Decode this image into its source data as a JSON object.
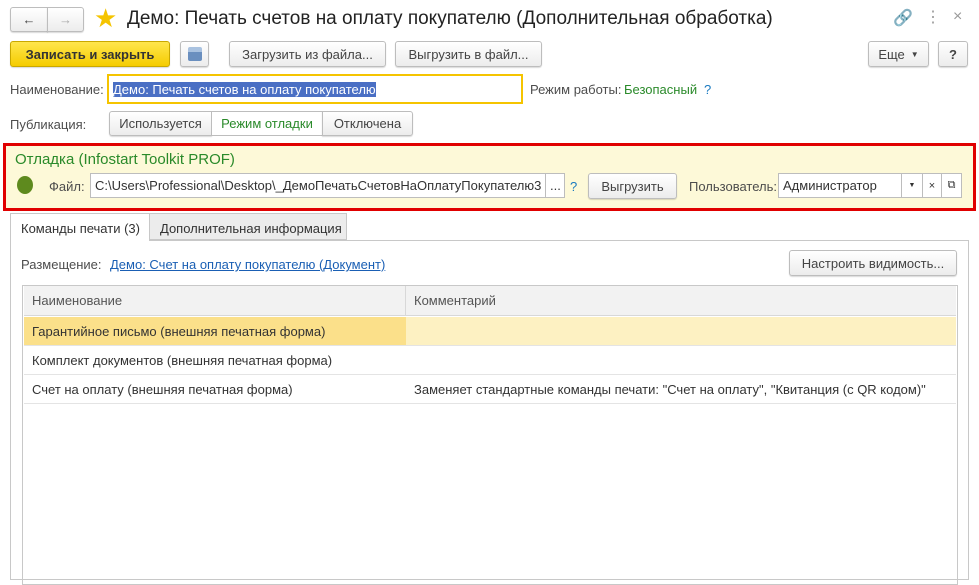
{
  "window": {
    "title": "Демо: Печать счетов на оплату покупателю (Дополнительная обработка)"
  },
  "toolbar": {
    "save_close": "Записать и закрыть",
    "load": "Загрузить из файла...",
    "unload": "Выгрузить в файл...",
    "more": "Еще",
    "help": "?"
  },
  "form": {
    "name_label": "Наименование:",
    "name_value": "Демо: Печать счетов на оплату покупателю",
    "mode_label": "Режим работы:",
    "mode_value": "Безопасный",
    "mode_help": "?",
    "publication_label": "Публикация:",
    "publication_options": [
      "Используется",
      "Режим отладки",
      "Отключена"
    ],
    "publication_selected": "Режим отладки"
  },
  "debug": {
    "title": "Отладка (Infostart Toolkit PROF)",
    "file_label": "Файл:",
    "file_value": "C:\\Users\\Professional\\Desktop\\_ДемоПечатьСчетовНаОплатуПокупателю3",
    "browse": "...",
    "help": "?",
    "unload": "Выгрузить",
    "user_label": "Пользователь:",
    "user_value": "Администратор"
  },
  "tabs": [
    {
      "label": "Команды печати (3)",
      "active": true
    },
    {
      "label": "Дополнительная информация",
      "active": false
    }
  ],
  "commands": {
    "placement_label": "Размещение:",
    "placement_link": "Демо: Счет на оплату покупателю (Документ)",
    "visibility_button": "Настроить видимость...",
    "columns": [
      "Наименование",
      "Комментарий"
    ],
    "rows": [
      [
        "Гарантийное письмо (внешняя печатная форма)",
        ""
      ],
      [
        "Комплект документов (внешняя печатная форма)",
        ""
      ],
      [
        "Счет на оплату (внешняя печатная форма)",
        "Заменяет стандартные команды печати: \"Счет на оплату\", \"Квитанция (с QR кодом)\""
      ]
    ]
  },
  "colors": {
    "accent": "#f5cc00",
    "debug_border": "#e00000",
    "debug_bg": "#fdf9d8",
    "selected_row": "#fbe08a",
    "green": "#2a8a2a"
  }
}
